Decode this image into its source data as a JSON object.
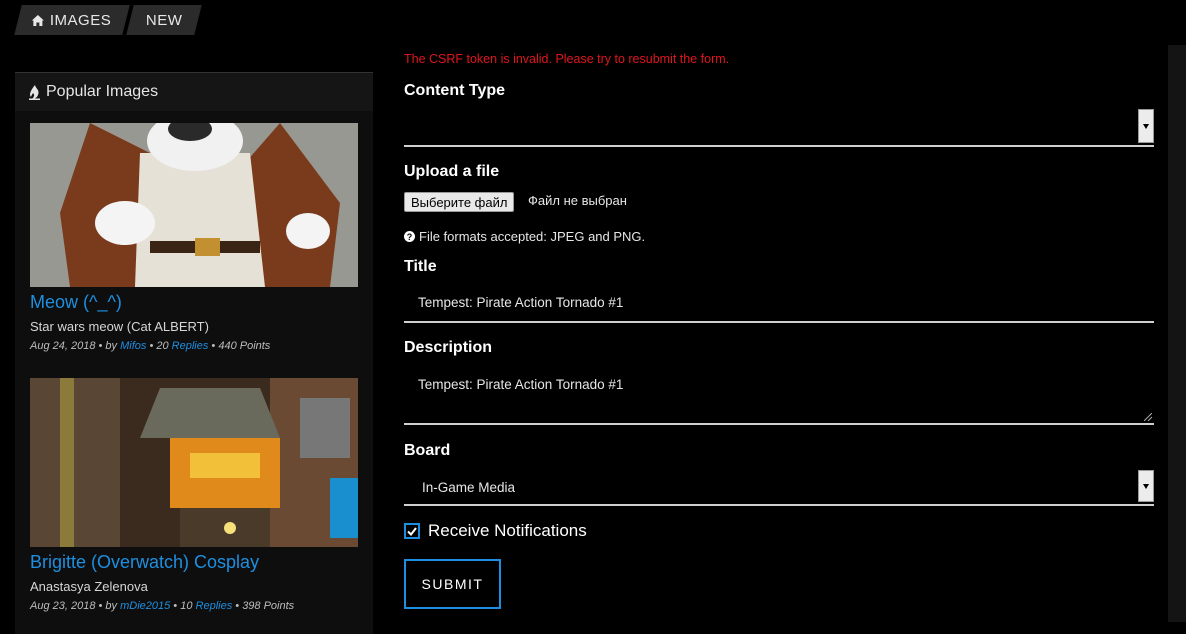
{
  "breadcrumb": {
    "home_label": "IMAGES",
    "home_icon": "home-icon",
    "new_label": "NEW"
  },
  "sidebar": {
    "title": "Popular Images",
    "title_icon": "fire-icon",
    "items": [
      {
        "title": "Meow (^_^)",
        "subtitle": "Star wars meow (Cat ALBERT)",
        "date": "Aug 24, 2018",
        "by": "by",
        "author": "Mifos",
        "replies_count": "20",
        "replies_label": "Replies",
        "points": "440 Points"
      },
      {
        "title": "Brigitte (Overwatch) Cosplay",
        "subtitle": "Anastasya Zelenova",
        "date": "Aug 23, 2018",
        "by": "by",
        "author": "mDie2015",
        "replies_count": "10",
        "replies_label": "Replies",
        "points": "398 Points"
      }
    ]
  },
  "form": {
    "error": "The CSRF token is invalid. Please try to resubmit the form.",
    "content_type_label": "Content Type",
    "content_type_value": "",
    "upload_label": "Upload a file",
    "file_button": "Выберите файл",
    "file_status": "Файл не выбран",
    "file_hint": "File formats accepted: JPEG and PNG.",
    "title_label": "Title",
    "title_value": "Tempest: Pirate Action Tornado #1",
    "description_label": "Description",
    "description_value": "Tempest: Pirate Action Tornado #1",
    "board_label": "Board",
    "board_value": "In-Game Media",
    "notifications_label": "Receive Notifications",
    "notifications_checked": true,
    "submit_label": "SUBMIT"
  },
  "colors": {
    "accent": "#1e8fe0",
    "error": "#e0141e",
    "background": "#000000"
  }
}
